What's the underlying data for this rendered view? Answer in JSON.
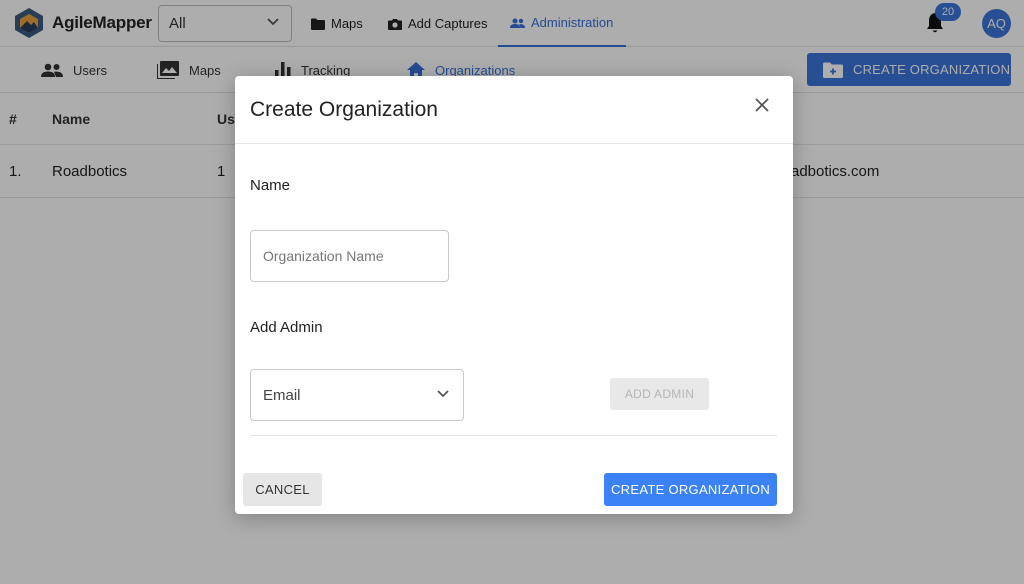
{
  "app": {
    "name": "AgileMapper"
  },
  "topbar": {
    "filter_select": {
      "value": "All"
    },
    "nav": [
      {
        "label": "Maps",
        "icon": "folder-icon"
      },
      {
        "label": "Add Captures",
        "icon": "camera-icon"
      },
      {
        "label": "Administration",
        "icon": "people-icon",
        "active": true
      }
    ],
    "notifications_count": "20",
    "avatar_initials": "AQ"
  },
  "subnav": {
    "tabs": [
      {
        "label": "Users",
        "icon": "people-icon"
      },
      {
        "label": "Maps",
        "icon": "image-icon"
      },
      {
        "label": "Tracking",
        "icon": "bar-chart-icon"
      },
      {
        "label": "Organizations",
        "icon": "home-icon",
        "active": true
      }
    ],
    "create_button_label": "CREATE ORGANIZATION"
  },
  "table": {
    "headers": [
      "#",
      "Name",
      "Us"
    ],
    "rows": [
      {
        "index": "1.",
        "name": "Roadbotics",
        "users": "1",
        "email_suffix": "adbotics.com"
      }
    ]
  },
  "modal": {
    "title": "Create Organization",
    "name_label": "Name",
    "name_placeholder": "Organization Name",
    "admin_label": "Add Admin",
    "email_value": "Email",
    "add_admin_label": "ADD ADMIN",
    "cancel_label": "CANCEL",
    "create_label": "CREATE ORGANIZATION"
  },
  "colors": {
    "accent": "#3b73d9",
    "primary_button": "#3b82f6",
    "overlay": "rgba(0,0,0,0.32)"
  }
}
